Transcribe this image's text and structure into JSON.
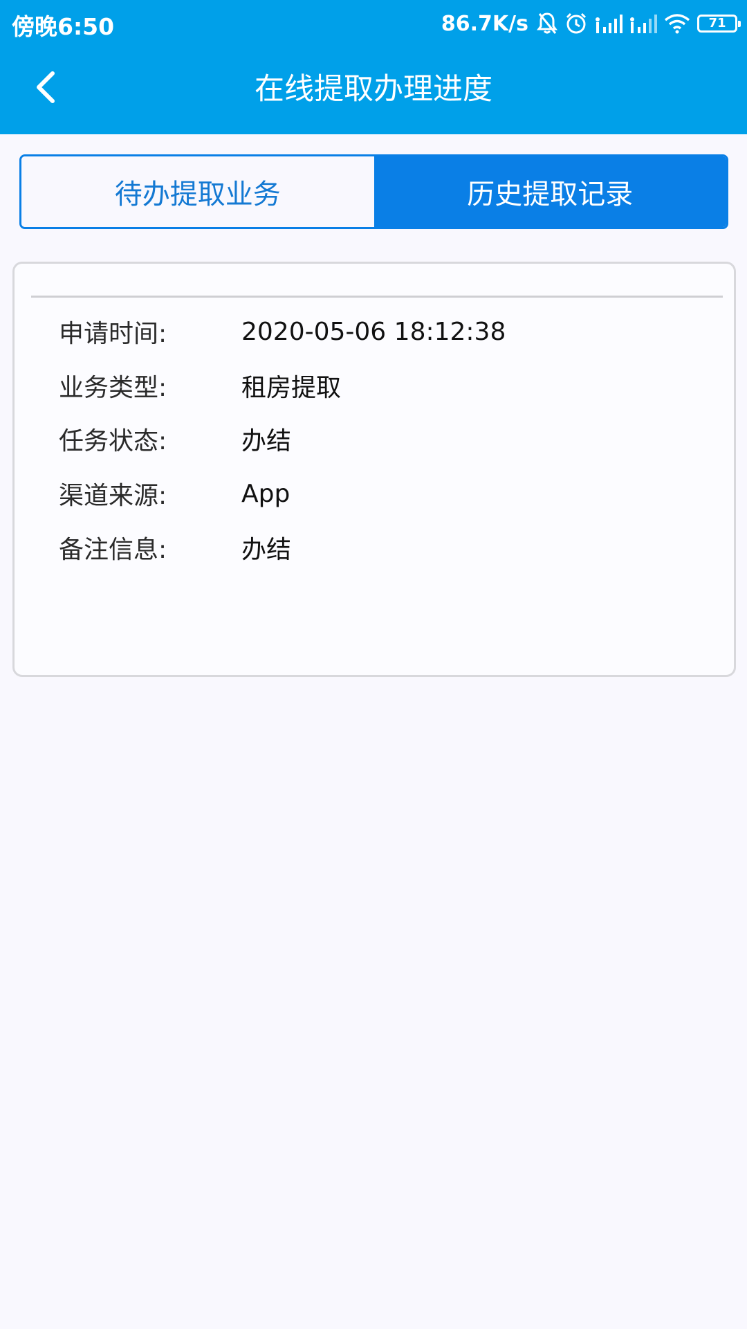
{
  "status_bar": {
    "time": "傍晚6:50",
    "net_speed": "86.7K/s",
    "battery_level": "71",
    "icons": [
      "bell-off-icon",
      "alarm-icon",
      "signal-icon",
      "signal-icon",
      "wifi-icon",
      "battery-icon"
    ]
  },
  "header": {
    "back_icon": "chevron-left-icon",
    "title": "在线提取办理进度"
  },
  "tabs": [
    {
      "label": "待办提取业务",
      "active": false
    },
    {
      "label": "历史提取记录",
      "active": true
    }
  ],
  "record": {
    "rows": [
      {
        "label": "申请时间:",
        "value": "2020-05-06 18:12:38"
      },
      {
        "label": "业务类型:",
        "value": "租房提取"
      },
      {
        "label": "任务状态:",
        "value": "办结"
      },
      {
        "label": "渠道来源:",
        "value": "App"
      },
      {
        "label": "备注信息:",
        "value": "办结"
      }
    ]
  },
  "colors": {
    "header_blue": "#00a0e9",
    "tab_active": "#0a7fe6",
    "tab_inactive_text": "#1479d3",
    "background": "#f9f8fe"
  }
}
